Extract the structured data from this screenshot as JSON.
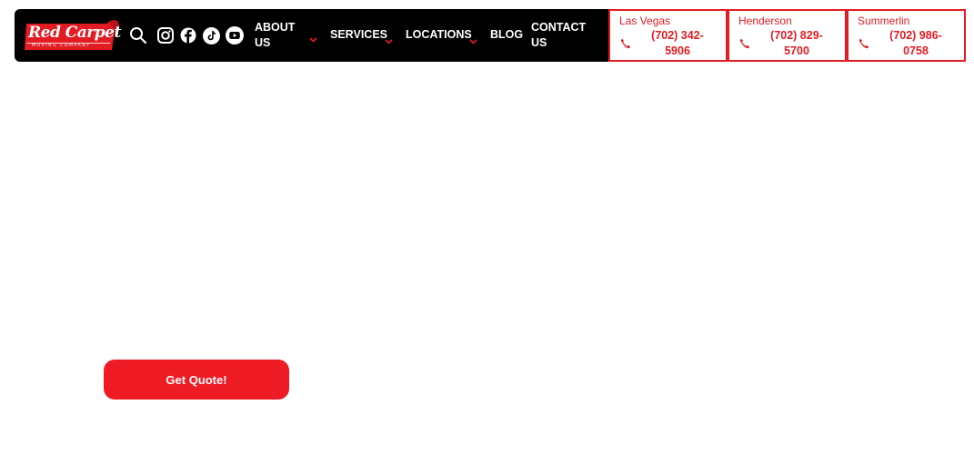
{
  "brand": {
    "name": "Red Carpet",
    "tagline": "MOVING COMPANY",
    "color": "#e31b23"
  },
  "header": {
    "icons": [
      "search-icon",
      "instagram-icon",
      "facebook-icon",
      "tiktok-icon",
      "youtube-icon"
    ],
    "nav": {
      "about_line1": "ABOUT",
      "about_line2": "US",
      "services": "SERVICES",
      "locations": "LOCATIONS",
      "blog": "BLOG",
      "contact_line1": "CONTACT",
      "contact_line2": "US"
    }
  },
  "phones": [
    {
      "location": "Las Vegas",
      "line1": "(702) 342-",
      "line2": "5906"
    },
    {
      "location": "Henderson",
      "line1": "(702) 829-",
      "line2": "5700"
    },
    {
      "location": "Summerlin",
      "line1": "(702) 986-",
      "line2": "0758"
    }
  ],
  "hero": {
    "cta_label": "Get Quote!",
    "cta_color": "#ee1b24"
  }
}
